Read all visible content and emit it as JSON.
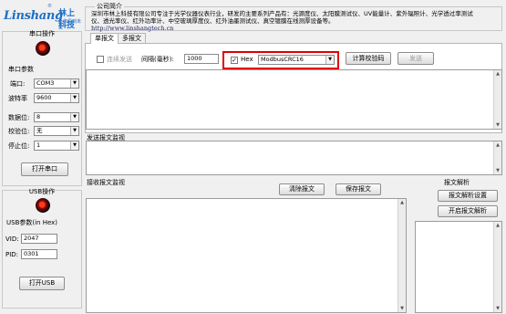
{
  "logo": {
    "word": "Linshang",
    "registered": "®",
    "cn_name": "林上科技",
    "slogan": "让你看到未来"
  },
  "intro": {
    "legend": "公司简介",
    "text": "深圳市林上科技有限公司专注于光学仪器仪表行业，研发的主要系列产品有：光源度仪、太阳膜测试仪、UV能量计、紫外辐照计、光学透过率测试仪、透光率仪、红外功率计、中空玻璃厚度仪、红外油墨测试仪、真空镀膜在线测厚设备等。",
    "link": "http://www.linshangtech.cn"
  },
  "serial": {
    "title": "串口操作",
    "params_legend": "串口参数",
    "port_label": "端口:",
    "port_value": "COM3",
    "baud_label": "波特率",
    "baud_value": "9600",
    "databits_label": "数据位:",
    "databits_value": "8",
    "parity_label": "校验位:",
    "parity_value": "无",
    "stopbits_label": "停止位:",
    "stopbits_value": "1",
    "open_button": "打开串口"
  },
  "usb": {
    "title": "USB操作",
    "params_legend": "USB参数(in Hex)",
    "vid_label": "VID:",
    "vid_value": "2047",
    "pid_label": "PID:",
    "pid_value": "0301",
    "open_button": "打开USB"
  },
  "tabs": {
    "single": "单报文",
    "multi": "多报文"
  },
  "send_controls": {
    "continuous_label": "连续发送",
    "interval_label": "间隔(毫秒):",
    "interval_value": "1000",
    "hex_label": "Hex",
    "hex_checked": "✓",
    "checksum_value": "ModbusCRC16",
    "compute_button": "计算校验码",
    "send_button": "发送"
  },
  "send_monitor": {
    "legend": "发送报文监视"
  },
  "recv_monitor": {
    "legend": "接收报文监视",
    "clear_button": "清除报文",
    "save_button": "保存报文"
  },
  "parse": {
    "legend": "报文解析",
    "settings_button": "报文解析设置",
    "start_button": "开启报文解析"
  }
}
